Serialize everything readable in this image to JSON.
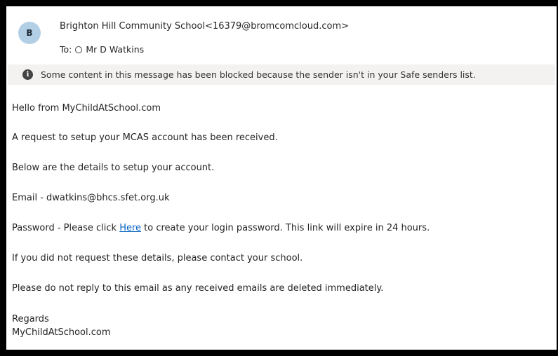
{
  "sender": {
    "avatar_initial": "B",
    "display": "Brighton Hill Community School<16379@bromcomcloud.com>",
    "to_prefix": "To:",
    "to_name": "Mr D Watkins"
  },
  "banner": {
    "icon": "info-icon",
    "text": "Some content in this message has been blocked because the sender isn't in your Safe senders list."
  },
  "message": {
    "greeting": "Hello from MyChildAtSchool.com",
    "request": "A request to setup your MCAS account has been received.",
    "details_intro": "Below are the details to setup your account.",
    "email_line": "Email - dwatkins@bhcs.sfet.org.uk",
    "password_before": "Password - Please click ",
    "password_link": "Here",
    "password_after": " to create your login password. This link will expire in 24 hours.",
    "not_requested": "If you did not request these details, please contact your school.",
    "no_reply": "Please do not reply to this email as any received emails are deleted immediately.",
    "regards": "Regards",
    "signature": "MyChildAtSchool.com"
  },
  "colors": {
    "link": "#0563c1",
    "avatar_bg": "#b2cfe6",
    "banner_bg": "#f3f2f1"
  }
}
